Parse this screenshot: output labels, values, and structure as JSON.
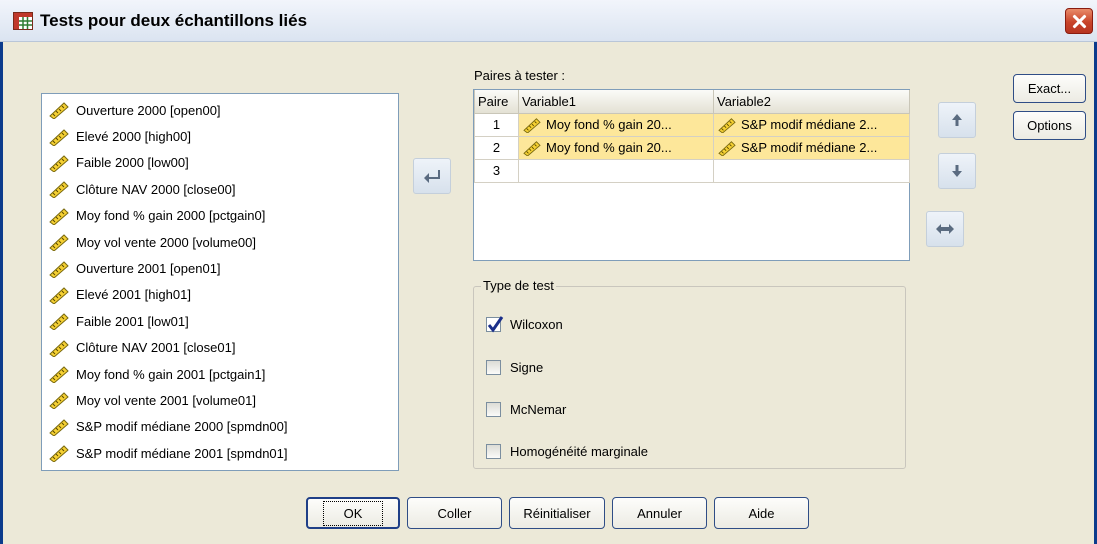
{
  "window": {
    "title": "Tests pour deux échantillons liés",
    "close_icon": "close-icon"
  },
  "colors": {
    "window_border": "#0b3b8c",
    "dialog_bg": "#ece9d8",
    "selected_cell": "#fde79a",
    "close_button": "#c8442a"
  },
  "source_list": {
    "item_icon": "scale-ruler-icon",
    "items": [
      "Ouverture 2000 [open00]",
      "Elevé 2000 [high00]",
      "Faible 2000 [low00]",
      "Clôture NAV 2000 [close00]",
      "Moy fond % gain 2000 [pctgain0]",
      "Moy vol vente 2000 [volume00]",
      "Ouverture 2001 [open01]",
      "Elevé 2001 [high01]",
      "Faible 2001 [low01]",
      "Clôture NAV 2001 [close01]",
      "Moy fond % gain 2001 [pctgain1]",
      "Moy vol vente 2001 [volume01]",
      "S&P modif médiane 2000 [spmdn00]",
      "S&P modif médiane 2001 [spmdn01]"
    ]
  },
  "pairs": {
    "label": "Paires à tester :",
    "headers": [
      "Paire",
      "Variable1",
      "Variable2"
    ],
    "rows": [
      {
        "num": "1",
        "var1": "Moy fond % gain 20...",
        "var2": "S&P modif médiane 2..."
      },
      {
        "num": "2",
        "var1": "Moy fond % gain 20...",
        "var2": "S&P modif médiane 2..."
      },
      {
        "num": "3",
        "var1": "",
        "var2": ""
      }
    ]
  },
  "move_buttons": {
    "transfer_icon": "arrow-left-icon",
    "up_icon": "arrow-up-icon",
    "down_icon": "arrow-down-icon",
    "swap_icon": "swap-horizontal-icon"
  },
  "test_type": {
    "legend": "Type de test",
    "options": [
      {
        "label": "Wilcoxon",
        "checked": true
      },
      {
        "label": "Signe",
        "checked": false
      },
      {
        "label": "McNemar",
        "checked": false
      },
      {
        "label": "Homogénéité marginale",
        "checked": false
      }
    ]
  },
  "side_buttons": {
    "exact": "Exact...",
    "options": "Options"
  },
  "footer_buttons": {
    "ok": "OK",
    "paste": "Coller",
    "reset": "Réinitialiser",
    "cancel": "Annuler",
    "help": "Aide"
  }
}
